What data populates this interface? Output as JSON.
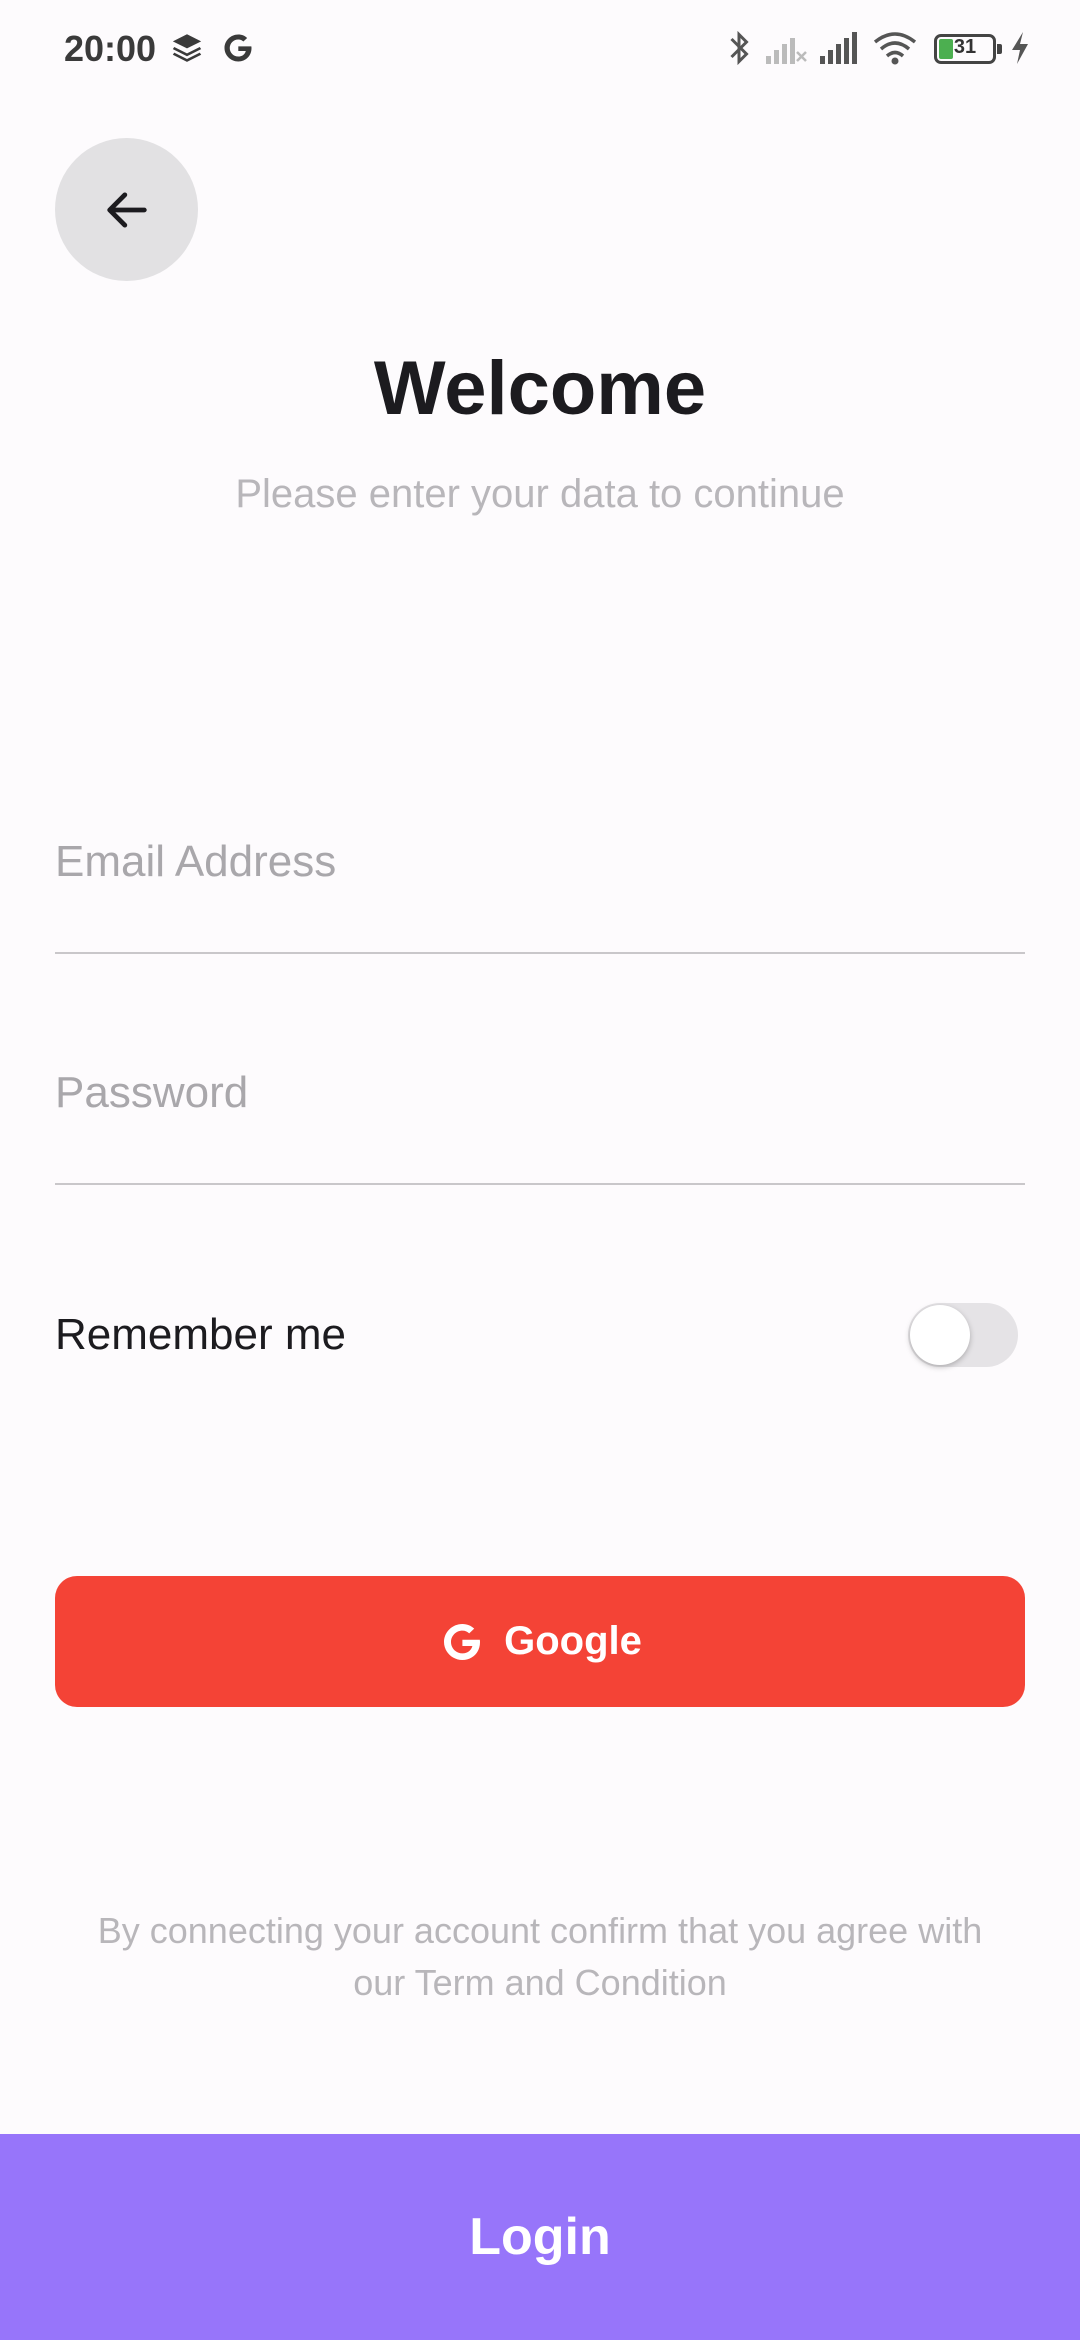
{
  "status_bar": {
    "time": "20:00",
    "battery": "31",
    "icons": [
      "layers-icon",
      "google-g-icon",
      "bluetooth-icon",
      "signal-no-service-icon",
      "signal-icon",
      "wifi-icon",
      "battery-icon",
      "charging-icon"
    ]
  },
  "header": {
    "back_icon": "arrow-left-icon",
    "title": "Welcome",
    "subtitle": "Please enter your data to continue"
  },
  "form": {
    "email_placeholder": "Email Address",
    "email_value": "",
    "password_placeholder": "Password",
    "password_value": "",
    "remember_label": "Remember me",
    "remember_on": false
  },
  "google_button": {
    "label": "Google",
    "icon": "google-g-icon",
    "color": "#f44336"
  },
  "terms": {
    "line1": "By connecting your account confirm that you agree with",
    "line2": "our Term and Condition"
  },
  "login_button": {
    "label": "Login",
    "color": "#9775fa"
  }
}
